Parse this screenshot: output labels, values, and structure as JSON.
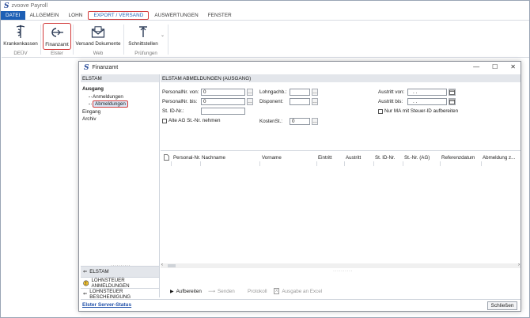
{
  "app": {
    "title": "zvoove Payroll",
    "menu": [
      "DATEI",
      "ALLGEMEIN",
      "LOHN",
      "EXPORT / VERSAND",
      "AUSWERTUNGEN",
      "FENSTER"
    ]
  },
  "ribbon": {
    "groups": [
      {
        "label": "DEÜV",
        "buttons": [
          "Krankenkassen"
        ]
      },
      {
        "label": "Elster",
        "buttons": [
          "Finanzamt"
        ]
      },
      {
        "label": "Web",
        "buttons": [
          "Versand Dokumente"
        ]
      },
      {
        "label": "Prüfungen",
        "buttons": [
          "Schnittstellen"
        ]
      }
    ]
  },
  "dialog": {
    "title": "Finanzamt",
    "left_header": "ELSTAM",
    "tree": {
      "ausgang": "Ausgang",
      "anmeldungen": "Anmeldungen",
      "abmeldungen": "Abmeldungen",
      "eingang": "Eingang",
      "archiv": "Archiv"
    },
    "nav": {
      "elstam": "ELSTAM",
      "lohnsteuer_anmeldungen": "LOHNSTEUER ANMELDUNGEN",
      "lohnsteuer_bescheinigung": "LOHNSTEUER BESCHEINIGUNG"
    },
    "right_header": "ELSTAM ABMELDUNGEN (AUSGANG)",
    "filters": {
      "personalnr_von_label": "PersonalNr. von:",
      "personalnr_von": "0",
      "personalnr_bis_label": "PersonalNr. bis:",
      "personalnr_bis": "0",
      "st_id_label": "St. ID-Nr.:",
      "st_id": "",
      "alte_ag_label": "Alte AG St.-Nr. nehmen",
      "lohngachb_label": "Lohngachb.:",
      "lohngachb": "",
      "disponent_label": "Disponent:",
      "disponent": "",
      "kostenst_label": "KostenSt.:",
      "kostenst": "0",
      "austritt_von_label": "Austritt von:",
      "austritt_von": ". .",
      "austritt_bis_label": "Austritt bis:",
      "austritt_bis": ". .",
      "nur_ma_label": "Nur MA mit Steuer-ID aufbereiten"
    },
    "columns": [
      "Personal-Nr.",
      "Nachname",
      "Vorname",
      "Eintritt",
      "Austritt",
      "St. ID-Nr.",
      "St.-Nr. (AG)",
      "Referenzdatum",
      "Abmeldung z..."
    ],
    "actions": {
      "aufbereiten": "Aufbereiten",
      "senden": "Senden",
      "protokoll": "Protokoll",
      "excel": "Ausgabe an Excel"
    },
    "footer_link": "Elster Server-Status",
    "close_label": "Schließen"
  },
  "colors": {
    "accent": "#1d5fb5",
    "highlight": "#d23a3a",
    "header_bg": "#e3e6eb"
  }
}
